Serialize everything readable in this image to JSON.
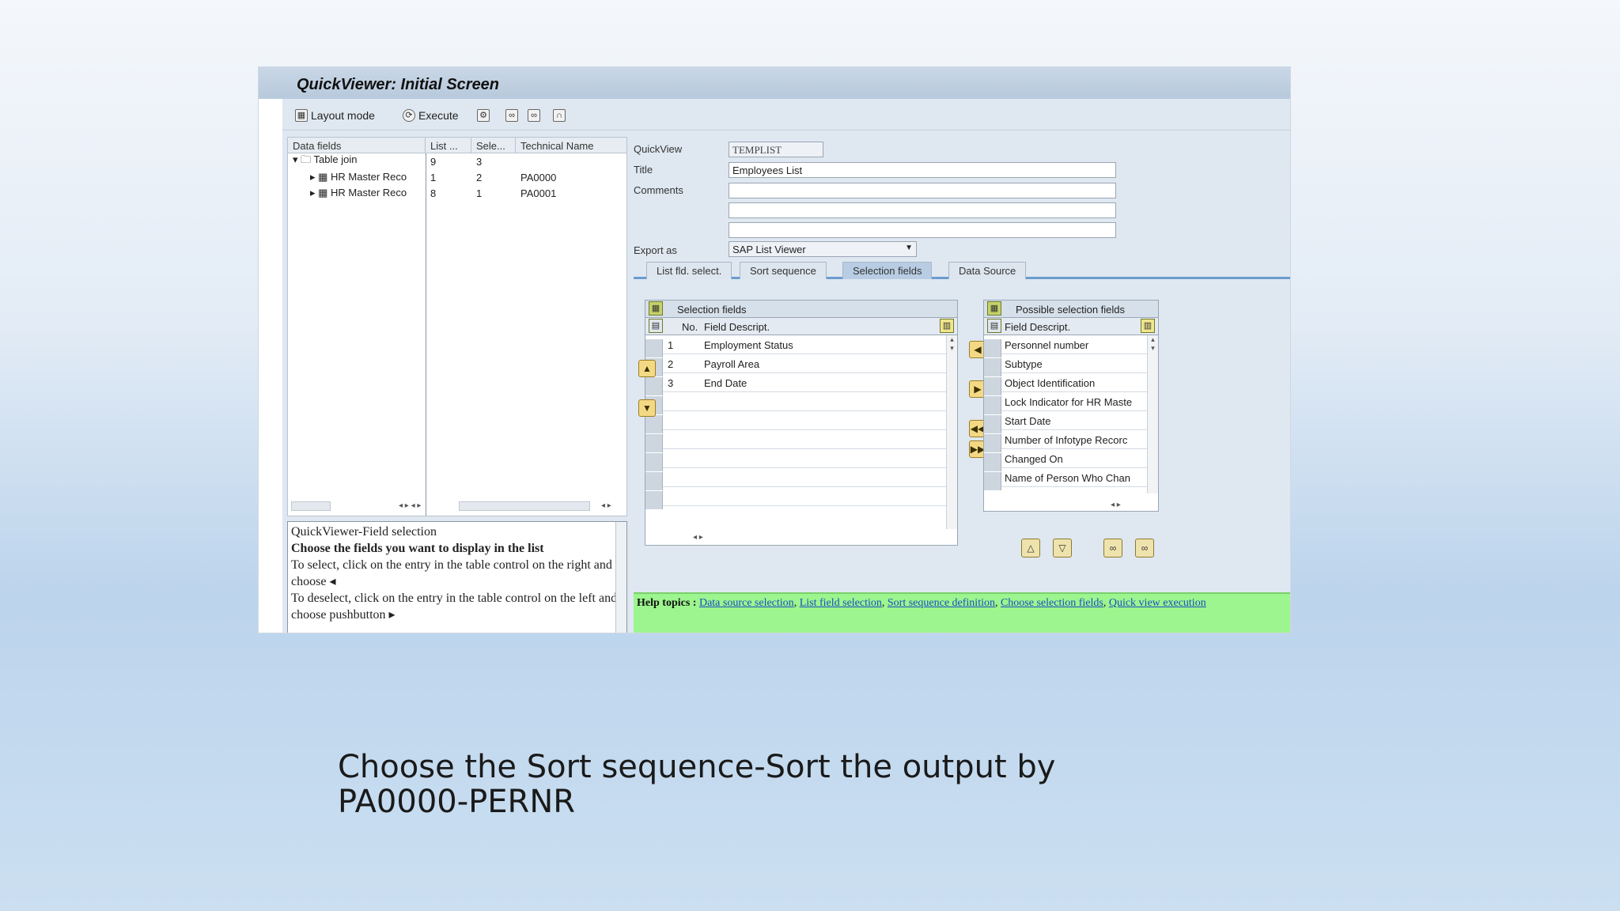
{
  "window": {
    "title": "QuickViewer: Initial Screen"
  },
  "toolbar": {
    "layout_mode": "Layout mode",
    "execute": "Execute"
  },
  "tree": {
    "headers": [
      "Data fields",
      "List ...",
      "Sele...",
      "Technical Name"
    ],
    "rows": [
      {
        "name": "Table join",
        "list": "9",
        "sel": "3",
        "tech": ""
      },
      {
        "name": "HR Master Reco",
        "list": "1",
        "sel": "2",
        "tech": "PA0000"
      },
      {
        "name": "HR Master Reco",
        "list": "8",
        "sel": "1",
        "tech": "PA0001"
      }
    ]
  },
  "help_text": {
    "title": "QuickViewer-Field selection",
    "subtitle": "Choose the fields you want to display in the list",
    "line1": "To select, click on the entry in the table control on the right and choose",
    "line2": "To deselect, click on the entry in the table control on the left and choose pushbutton"
  },
  "form": {
    "quickview_label": "QuickView",
    "quickview_value": "TEMPLIST",
    "title_label": "Title",
    "title_value": "Employees List",
    "comments_label": "Comments",
    "export_label": "Export as",
    "export_value": "SAP List Viewer"
  },
  "tabs": [
    "List fld. select.",
    "Sort sequence",
    "Selection fields",
    "Data Source"
  ],
  "active_tab": "Selection fields",
  "selection_panel": {
    "title": "Selection fields",
    "col_no": "No.",
    "col_desc": "Field Descript.",
    "rows": [
      {
        "no": "1",
        "desc": "Employment Status"
      },
      {
        "no": "2",
        "desc": "Payroll Area"
      },
      {
        "no": "3",
        "desc": "End Date"
      }
    ]
  },
  "possible_panel": {
    "title": "Possible selection fields",
    "col_desc": "Field Descript.",
    "rows": [
      "Personnel number",
      "Subtype",
      "Object Identification",
      "Lock Indicator for HR Maste",
      "Start Date",
      "Number of Infotype Recorc",
      "Changed On",
      "Name of Person Who Chan"
    ]
  },
  "helpbar": {
    "title": "Help topics :",
    "links": [
      "Data source selection",
      "List field selection",
      "Sort sequence definition",
      "Choose selection fields",
      "Quick view execution"
    ]
  },
  "caption": {
    "line1": "Choose the Sort sequence-Sort the output by",
    "line2": "PA0000-PERNR"
  }
}
